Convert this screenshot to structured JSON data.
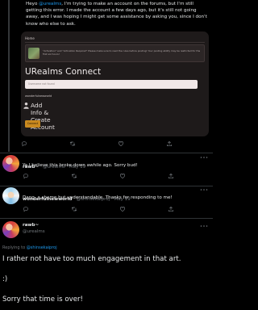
{
  "top_tweet": {
    "prefix": "Heyo ",
    "mention": "@urealms",
    "text": ", I'm trying to make an account on the forums, but I'm still getting this error. I made the account a few days ago, but it's still not going away, and I was hoping I might get some assistance by asking you, since I don't know who else to ask.",
    "screenshot": {
      "home": "Home",
      "notice": "\"Activation\" and \"Activation Required\" Please make sure to read the rules before posting! Your posting ability may be restricted for the first six hours!",
      "brand": "URealms Connect",
      "field_value": "Username not found",
      "prompt": "wonderfulnewworld",
      "add_label": "Add Info & Create Account",
      "button": "Connect"
    }
  },
  "reply1": {
    "name": "rawb~",
    "meta": "@urealms · May 19",
    "text": "Ya I believe this broke down awhile ago. Sorry bud!"
  },
  "reply2": {
    "name": "wonderfulnewworld",
    "meta": "@shinsekaiproj · May 19",
    "text": "Dang, a shame but understandable. Thanks for responding to me!"
  },
  "main_tweet": {
    "name": "rawb~",
    "handle": "@urealms",
    "replying_prefix": "Replying to ",
    "replying_handle": "@shinsekaiproj",
    "line1": "I rather not have too much engagement in that art.",
    "line2": ":)",
    "line3": "Sorry that time is over!"
  },
  "icons": [
    "reply-icon",
    "retweet-icon",
    "like-icon",
    "share-icon",
    "more-icon",
    "person-icon"
  ],
  "colors": {
    "background": "#000000",
    "accent": "#1d9bf0",
    "muted": "#71767b",
    "card_button": "#c9891f"
  }
}
